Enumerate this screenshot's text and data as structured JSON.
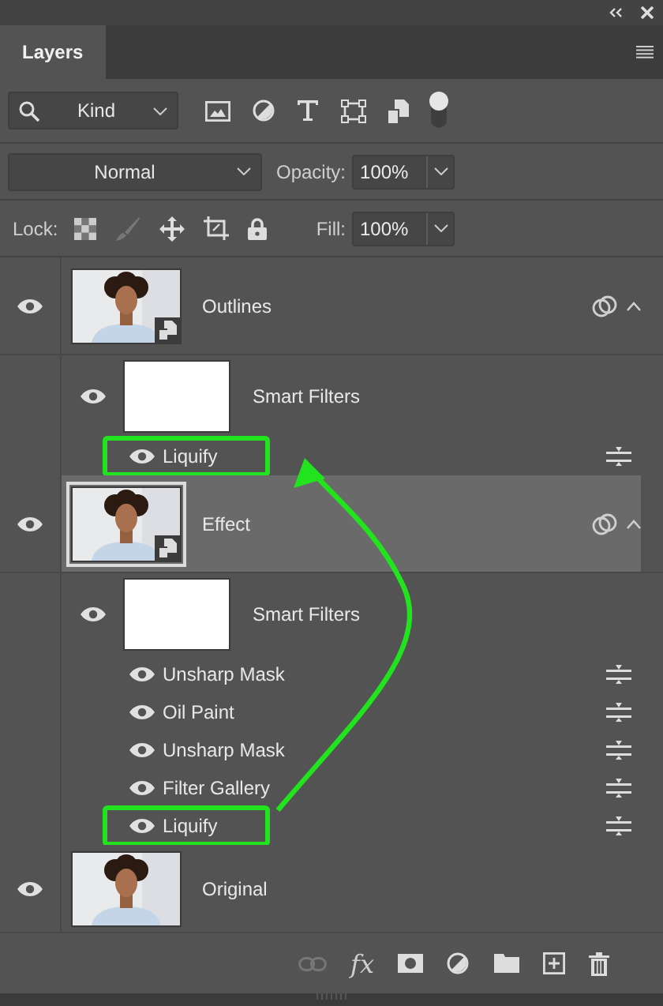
{
  "panel": {
    "tab": "Layers"
  },
  "filter": {
    "kind": "Kind",
    "toggle_on": true
  },
  "blend": {
    "mode": "Normal",
    "opacity_label": "Opacity:",
    "opacity": "100%"
  },
  "lock": {
    "label": "Lock:",
    "fill_label": "Fill:",
    "fill": "100%"
  },
  "layers": [
    {
      "name": "Outlines",
      "kind": "smart-object",
      "selected": false,
      "visible": true,
      "expanded": true,
      "smart_filters": {
        "label": "Smart Filters",
        "visible": true,
        "filters": [
          {
            "name": "Liquify",
            "visible": true,
            "highlighted": true
          }
        ]
      }
    },
    {
      "name": "Effect",
      "kind": "smart-object",
      "selected": true,
      "visible": true,
      "expanded": true,
      "smart_filters": {
        "label": "Smart Filters",
        "visible": true,
        "filters": [
          {
            "name": "Unsharp Mask",
            "visible": true,
            "highlighted": false
          },
          {
            "name": "Oil Paint",
            "visible": true,
            "highlighted": false
          },
          {
            "name": "Unsharp Mask",
            "visible": true,
            "highlighted": false
          },
          {
            "name": "Filter Gallery",
            "visible": true,
            "highlighted": false
          },
          {
            "name": "Liquify",
            "visible": true,
            "highlighted": true
          }
        ]
      }
    },
    {
      "name": "Original",
      "kind": "pixel",
      "selected": false,
      "visible": true
    }
  ],
  "bottom_bar": {
    "fx": "fx"
  }
}
